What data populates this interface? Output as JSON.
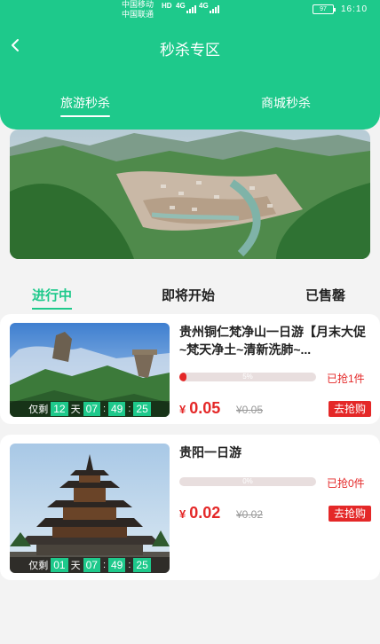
{
  "status_bar": {
    "carrier1": "中国移动",
    "carrier2": "中国联通",
    "net1": "4G",
    "net2": "4G",
    "hd": "HD",
    "battery": "97",
    "time": "16:10"
  },
  "header": {
    "title": "秒杀专区",
    "tabs": [
      {
        "label": "旅游秒杀",
        "active": true
      },
      {
        "label": "商城秒杀",
        "active": false
      }
    ]
  },
  "status_tabs": [
    {
      "label": "进行中",
      "active": true
    },
    {
      "label": "即将开始",
      "active": false
    },
    {
      "label": "已售罄",
      "active": false
    }
  ],
  "products": [
    {
      "name": "贵州铜仁梵净山一日游【月末大促~梵天净土~清新洗肺~...",
      "progress_label": "5%",
      "progress": 0.05,
      "sold": "已抢1件",
      "currency": "¥",
      "price": "0.05",
      "old_price": "¥0.05",
      "buy_label": "去抢购",
      "countdown": {
        "prefix": "仅剩",
        "days": "12",
        "day_unit": "天",
        "hours": "07",
        "minutes": "49",
        "seconds": "25"
      }
    },
    {
      "name": "贵阳一日游",
      "progress_label": "0%",
      "progress": 0,
      "sold": "已抢0件",
      "currency": "¥",
      "price": "0.02",
      "old_price": "¥0.02",
      "buy_label": "去抢购",
      "countdown": {
        "prefix": "仅剩",
        "days": "01",
        "day_unit": "天",
        "hours": "07",
        "minutes": "49",
        "seconds": "25"
      }
    }
  ],
  "colors": {
    "brand": "#1ec98b",
    "accent_red": "#e42828"
  }
}
